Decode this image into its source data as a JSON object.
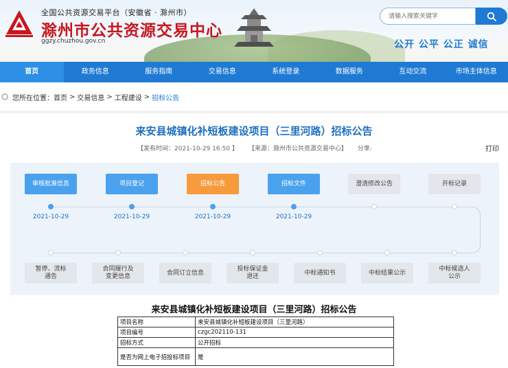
{
  "header": {
    "subtitle": "全国公共资源交易平台（安徽省 · 滁州市）",
    "title": "滁州市公共资源交易中心",
    "url": "ggzy.chuzhou.gov.cn",
    "search_placeholder": "请输入搜索关键字",
    "slogan": "公开 公平 公正 诚信",
    "brand_color": "#c8161d",
    "accent_color": "#1f7ad4"
  },
  "nav": {
    "items": [
      "首页",
      "政务信息",
      "服务指南",
      "交易信息",
      "系统登录",
      "数据服务",
      "互动交流",
      "市场主体信息"
    ],
    "active": "首页"
  },
  "breadcrumb": {
    "prefix": "您所在位置：",
    "items": [
      "首页",
      "交易信息",
      "工程建设",
      "招标公告"
    ],
    "separator": ">"
  },
  "announcement": {
    "title": "来安县城镇化补短板建设项目（三里河路）招标公告",
    "publish_time": "【发布时间：2021-10-29 16:50 】",
    "source": "【来源：滁州市公共资源交易中心】",
    "share": "分享:",
    "print": "打印"
  },
  "process": {
    "top_steps": [
      {
        "label": "审核批准信息",
        "state": "blue",
        "date": "2021-10-29"
      },
      {
        "label": "项目登记",
        "state": "blue",
        "date": "2021-10-29"
      },
      {
        "label": "招标公告",
        "state": "orange",
        "date": "2021-10-29"
      },
      {
        "label": "招标文件",
        "state": "blue",
        "date": "2021-10-29"
      },
      {
        "label": "澄清修改公告",
        "state": "gray",
        "date": ""
      },
      {
        "label": "开标记录",
        "state": "gray",
        "date": ""
      }
    ],
    "bottom_steps": [
      {
        "label": "暂停、流标\n通告"
      },
      {
        "label": "合同履行及\n变更信息"
      },
      {
        "label": "合同订立信息"
      },
      {
        "label": "投标保证金\n退还"
      },
      {
        "label": "中标通知书"
      },
      {
        "label": "中标结果公示"
      },
      {
        "label": "中标候选人\n公示"
      }
    ]
  },
  "document": {
    "title": "来安县城镇化补短板建设项目（三里河路）招标公告",
    "rows": [
      {
        "key": "项目名称",
        "value": "来安县城镇化补短板建设项目（三里河路）"
      },
      {
        "key": "项目编号",
        "value": "czgc202110-131"
      },
      {
        "key": "招标方式",
        "value": "公开招标"
      },
      {
        "key": "是否为网上电子招投标项目",
        "value": "是"
      }
    ]
  }
}
